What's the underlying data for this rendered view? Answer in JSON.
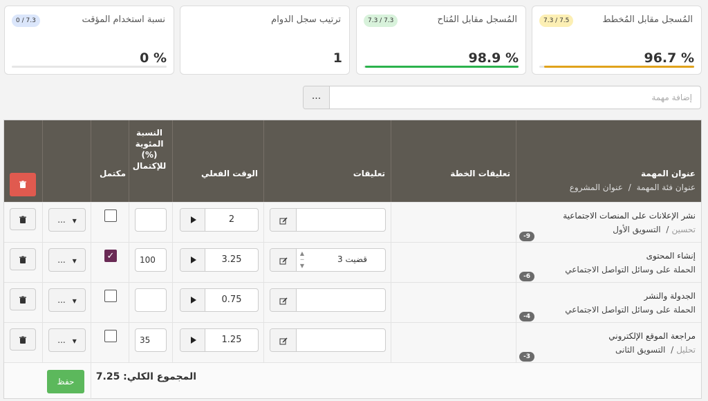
{
  "cards": [
    {
      "title": "المُسجل مقابل المُخطط",
      "badge": "7.3 / 7.5",
      "badge_bg": "#fcefb4",
      "value": "96.7 %",
      "bar_color": "#e0a21b",
      "bar_fill_percent": 96.7
    },
    {
      "title": "المُسجل مقابل المُتاح",
      "badge": "7.3 / 7.3",
      "badge_bg": "#d8f2db",
      "value": "98.9 %",
      "bar_color": "#2bb24c",
      "bar_fill_percent": 98.9
    },
    {
      "title": "ترتيب سجل الدوام",
      "badge": "",
      "badge_bg": "",
      "value": "1",
      "bar_color": "",
      "bar_fill_percent": 0
    },
    {
      "title": "نسبة استخدام المؤقت",
      "badge": "0 / 7.3",
      "badge_bg": "#dbe6fb",
      "value": "0 %",
      "bar_color": "#cccccc",
      "bar_fill_percent": 0
    }
  ],
  "add_task": {
    "placeholder": "إضافة مهمة",
    "menu_label": "..."
  },
  "table": {
    "headers": {
      "task_title": "عنوان المهمة",
      "task_subtitle_category": "عنوان فئة المهمة",
      "task_subtitle_sep": "/",
      "task_subtitle_project": "عنوان المشروع",
      "plan_comments": "تعليقات الخطة",
      "comments": "تعليقات",
      "actual_time": "الوقت الفعلي",
      "completion_pct": "النسبة المئوية (%) للإكتمال",
      "completed": "مكتمل"
    },
    "rows": [
      {
        "title": "نشر الإعلانات على المنصات الاجتماعية",
        "category": "تحسين",
        "project": "التسويق الأول",
        "badge": "-9",
        "comment": "",
        "time": "2",
        "percent": "",
        "completed": false
      },
      {
        "title": "إنشاء المحتوى",
        "category": "",
        "project": "الحملة على وسائل التواصل الاجتماعي",
        "badge": "-6",
        "comment": "قضيت 3",
        "time": "3.25",
        "percent": "100",
        "completed": true
      },
      {
        "title": "الجدولة والنشر",
        "category": "",
        "project": "الحملة على وسائل التواصل الاجتماعي",
        "badge": "-4",
        "comment": "",
        "time": "0.75",
        "percent": "",
        "completed": false
      },
      {
        "title": "مراجعة الموقع الإلكتروني",
        "category": "تحليل",
        "project": "التسويق الثانى",
        "badge": "-3",
        "comment": "",
        "time": "1.25",
        "percent": "35",
        "completed": false
      }
    ],
    "dropdown_label": "...",
    "total_label": "المجموع الكلي: 7.25",
    "save_label": "حفظ"
  },
  "icons": {
    "trash": "trash-icon",
    "edit": "edit-icon",
    "play": "play-icon",
    "caret": "caret-down-icon",
    "check": "check-icon"
  }
}
